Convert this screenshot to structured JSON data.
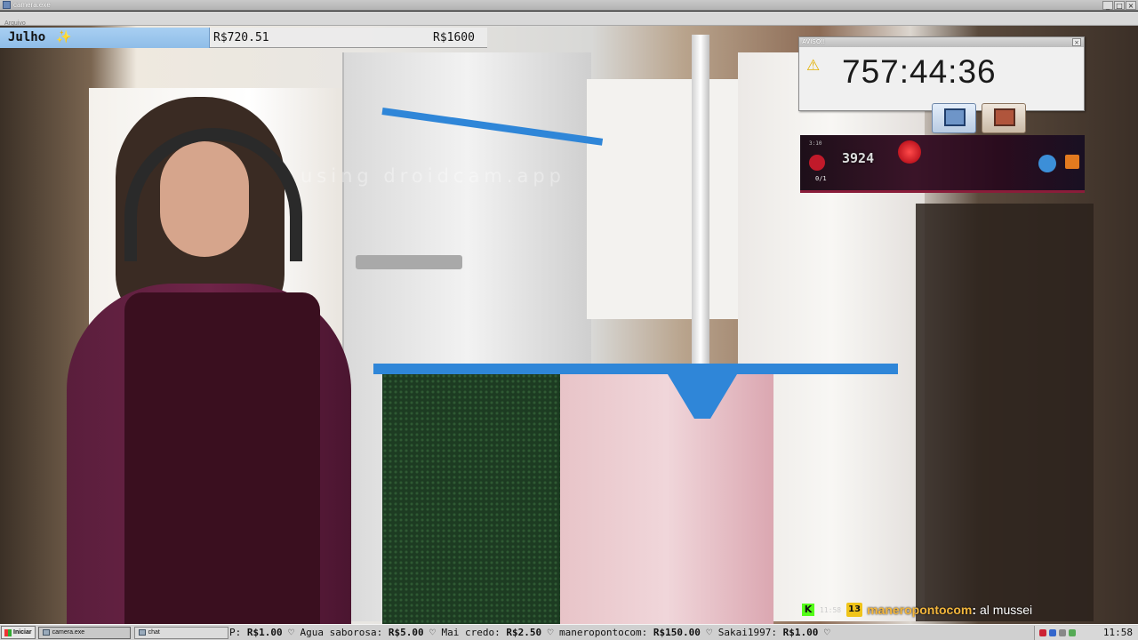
{
  "window": {
    "title": "camera.exe",
    "menu": "Arquivo",
    "controls": {
      "minimize": "_",
      "maximize": "□",
      "close": "×"
    }
  },
  "hud": {
    "month": "Julho",
    "month_emoji": "✨",
    "money": "R$720.51",
    "goal": "R$1600"
  },
  "watermark": "using droidcam.app",
  "alert": {
    "title": "AVISO!!",
    "close": "×",
    "warn_icon": "⚠",
    "timer": "757:44:36",
    "tiles": [
      {
        "icon": "program-icon-blue"
      },
      {
        "icon": "program-icon-brown"
      }
    ]
  },
  "game": {
    "clock": "3:10",
    "score": "3924",
    "ratio": "0/1"
  },
  "chat": {
    "platform_icon": "K",
    "time": "11:58",
    "badge": "13",
    "user": "maneropontocom",
    "separator": ":",
    "message": "al mussei"
  },
  "taskbar": {
    "start_label": "Iniciar",
    "tasks": [
      {
        "label": "camera.exe"
      },
      {
        "label": "chat"
      }
    ],
    "ticker": [
      {
        "name": "P:",
        "amount": "R$1.00",
        "sep": "♡"
      },
      {
        "name": "Agua saborosa:",
        "amount": "R$5.00",
        "sep": "♡"
      },
      {
        "name": "Mai credo:",
        "amount": "R$2.50",
        "sep": "♡"
      },
      {
        "name": "maneropontocom:",
        "amount": "R$150.00",
        "sep": "♡"
      },
      {
        "name": "Sakai1997:",
        "amount": "R$1.00",
        "sep": "♡"
      }
    ],
    "clock": "11:58"
  },
  "colors": {
    "accent_blue": "#2f86d8",
    "chat_user": "#f3b63c",
    "kick_green": "#53fc18",
    "warn_yellow": "#e2b000"
  }
}
